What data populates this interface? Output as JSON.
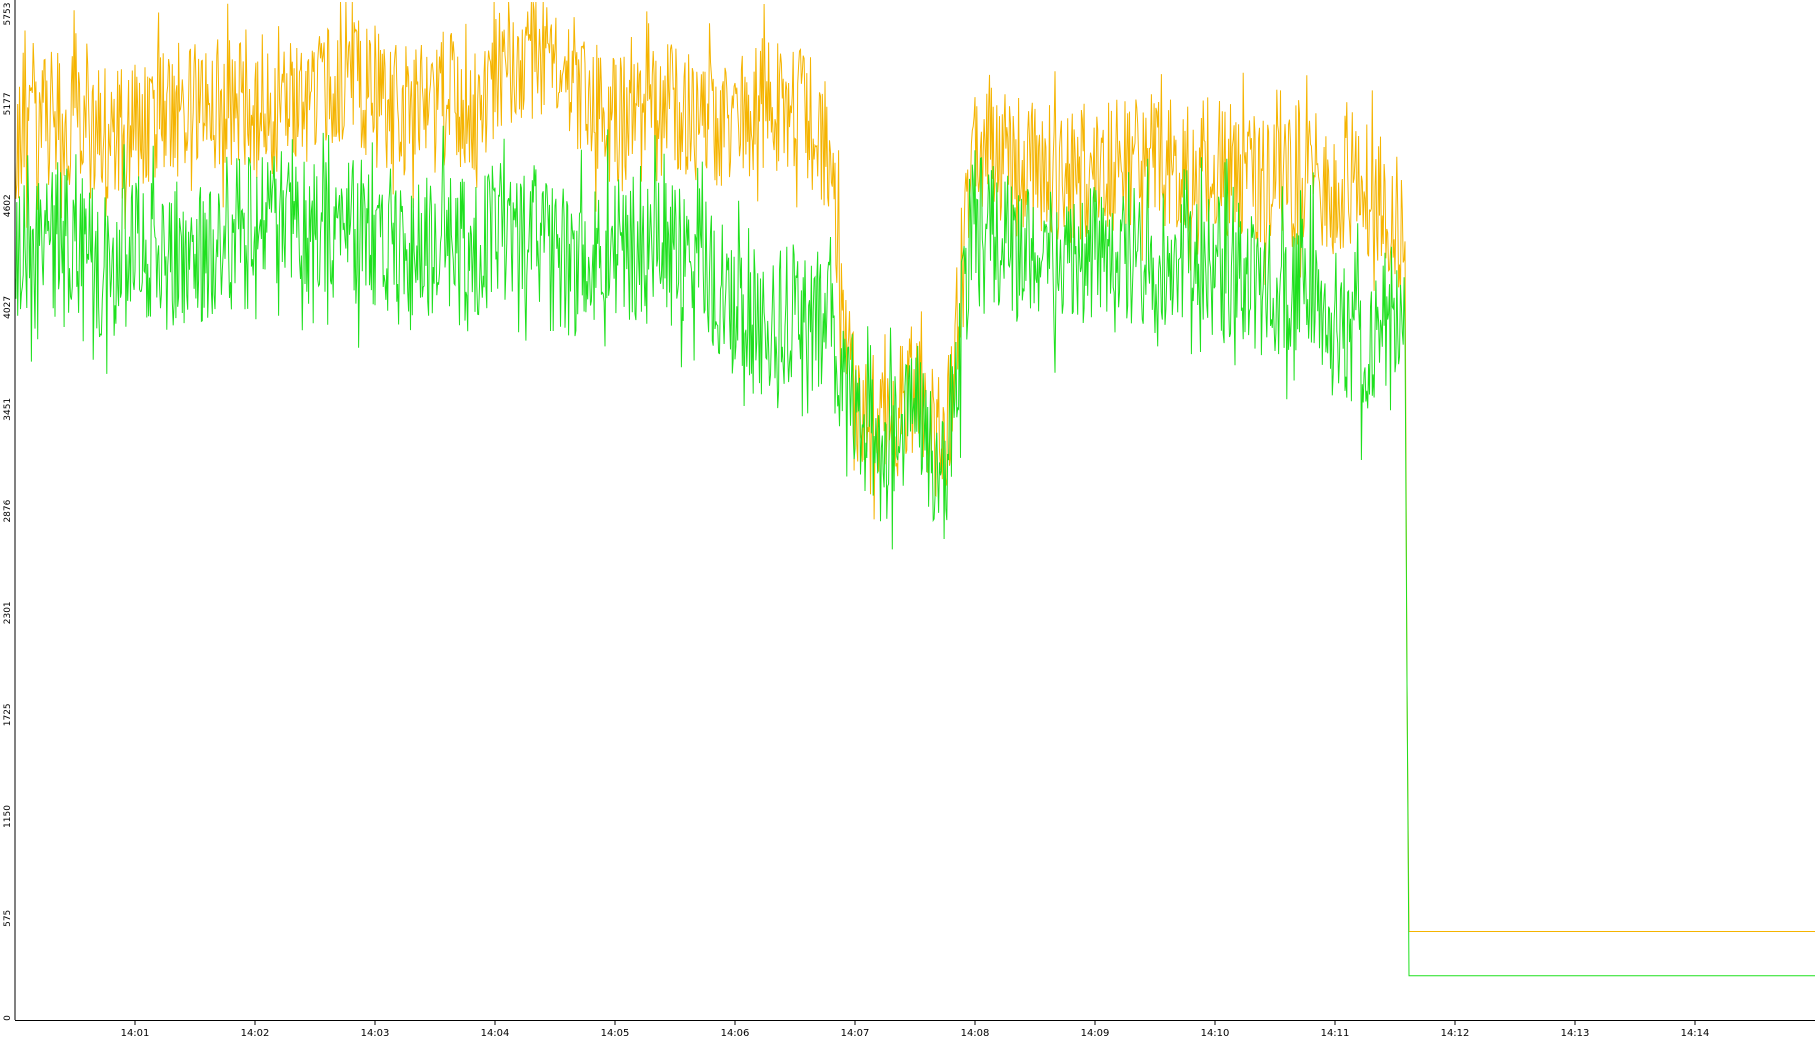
{
  "colors": {
    "background": "#ffffff",
    "axis": "#000000",
    "series_orange": "#f5b400",
    "series_green": "#1ee01e"
  },
  "chart_data": {
    "type": "line",
    "title": "",
    "xlabel": "",
    "ylabel": "",
    "grid": false,
    "legend": "none",
    "ylim": [
      0,
      5753
    ],
    "y_ticks": [
      "0",
      "575",
      "1150",
      "1725",
      "2301",
      "2876",
      "3451",
      "4027",
      "4602",
      "5177",
      "5753"
    ],
    "xlim": [
      "14:00:00",
      "14:15:00"
    ],
    "x_ticks": [
      "14:01",
      "14:02",
      "14:03",
      "14:04",
      "14:05",
      "14:06",
      "14:07",
      "14:08",
      "14:09",
      "14:10",
      "14:11",
      "14:12",
      "14:13",
      "14:14"
    ],
    "series": [
      {
        "color": "#f5b400",
        "sample_interval_s": 15,
        "x": [
          "14:00:00",
          "14:00:15",
          "14:00:30",
          "14:00:45",
          "14:01:00",
          "14:01:15",
          "14:01:30",
          "14:01:45",
          "14:02:00",
          "14:02:15",
          "14:02:30",
          "14:02:45",
          "14:03:00",
          "14:03:15",
          "14:03:30",
          "14:03:45",
          "14:04:00",
          "14:04:15",
          "14:04:30",
          "14:04:45",
          "14:05:00",
          "14:05:15",
          "14:05:30",
          "14:05:45",
          "14:06:00",
          "14:06:15",
          "14:06:30",
          "14:06:45",
          "14:07:00",
          "14:07:15",
          "14:07:30",
          "14:07:45",
          "14:08:00",
          "14:08:15",
          "14:08:30",
          "14:08:45",
          "14:09:00",
          "14:09:15",
          "14:09:30",
          "14:09:45",
          "14:10:00",
          "14:10:15",
          "14:10:30",
          "14:10:45",
          "14:11:00",
          "14:11:15",
          "14:11:30",
          "14:11:35",
          "14:11:36",
          "14:11:37",
          "14:15:00"
        ],
        "values": [
          5000,
          5050,
          5100,
          5000,
          5050,
          5100,
          5150,
          5200,
          5100,
          5150,
          5250,
          5350,
          5200,
          5150,
          5250,
          5100,
          5300,
          5400,
          5550,
          5200,
          5050,
          5100,
          5150,
          5100,
          5050,
          5200,
          5100,
          5150,
          3400,
          3300,
          3600,
          3200,
          4950,
          4900,
          4800,
          4750,
          4800,
          4850,
          4900,
          4800,
          4850,
          4750,
          4700,
          4750,
          4650,
          4700,
          4550,
          4400,
          1900,
          500,
          500
        ]
      },
      {
        "color": "#1ee01e",
        "sample_interval_s": 15,
        "x": [
          "14:00:00",
          "14:00:15",
          "14:00:30",
          "14:00:45",
          "14:01:00",
          "14:01:15",
          "14:01:30",
          "14:01:45",
          "14:02:00",
          "14:02:15",
          "14:02:30",
          "14:02:45",
          "14:03:00",
          "14:03:15",
          "14:03:30",
          "14:03:45",
          "14:04:00",
          "14:04:15",
          "14:04:30",
          "14:04:45",
          "14:05:00",
          "14:05:15",
          "14:05:30",
          "14:05:45",
          "14:06:00",
          "14:06:15",
          "14:06:30",
          "14:06:45",
          "14:07:00",
          "14:07:15",
          "14:07:30",
          "14:07:45",
          "14:08:00",
          "14:08:15",
          "14:08:30",
          "14:08:45",
          "14:09:00",
          "14:09:15",
          "14:09:30",
          "14:09:45",
          "14:10:00",
          "14:10:15",
          "14:10:30",
          "14:10:45",
          "14:11:00",
          "14:11:15",
          "14:11:30",
          "14:11:35",
          "14:11:36",
          "14:11:37",
          "14:15:00"
        ],
        "values": [
          4300,
          4400,
          4350,
          4250,
          4400,
          4300,
          4350,
          4400,
          4600,
          4550,
          4450,
          4500,
          4400,
          4300,
          4400,
          4350,
          4450,
          4350,
          4300,
          4250,
          4400,
          4350,
          4300,
          4300,
          4000,
          3900,
          4000,
          3950,
          3300,
          3200,
          3500,
          3100,
          4500,
          4400,
          4300,
          4250,
          4300,
          4350,
          4300,
          4250,
          4250,
          4200,
          4150,
          4200,
          4000,
          3800,
          4000,
          3900,
          1900,
          250,
          250
        ]
      }
    ]
  }
}
